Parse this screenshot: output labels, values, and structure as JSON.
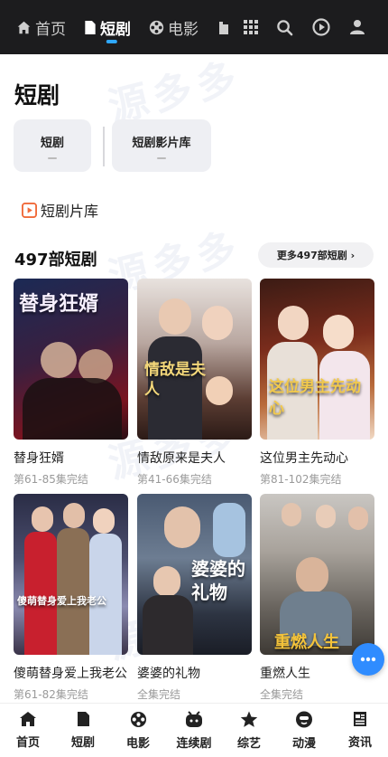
{
  "topnav": {
    "items": [
      {
        "label": "首页",
        "icon": "home-icon"
      },
      {
        "label": "短剧",
        "icon": "document-icon",
        "active": true
      },
      {
        "label": "电影",
        "icon": "film-reel-icon"
      }
    ],
    "right_icons": [
      "tv-icon",
      "grid-icon",
      "search-icon",
      "play-circle-icon",
      "user-icon"
    ],
    "accent": "#2fa8ff",
    "background": "#1c1c1e"
  },
  "watermark": "源多多",
  "page_title": "短剧",
  "categories": [
    {
      "label": "短剧"
    },
    {
      "label": "短剧影片库"
    }
  ],
  "library_label": "短剧片库",
  "section": {
    "title": "497部短剧",
    "more_label": "更多497部短剧 ›"
  },
  "cards": [
    {
      "title": "替身狂婿",
      "sub": "第61-85集完结",
      "poster_text": "替身狂婿"
    },
    {
      "title": "情敌原来是夫人",
      "sub": "第41-66集完结",
      "poster_text": "情敌是夫人"
    },
    {
      "title": "这位男主先动心",
      "sub": "第81-102集完结",
      "poster_text": "这位男主先动心"
    },
    {
      "title": "傻萌替身爱上我老公",
      "sub": "第61-82集完结",
      "poster_text": "傻萌替身爱上我老公"
    },
    {
      "title": "婆婆的礼物",
      "sub": "全集完结",
      "poster_text": "婆婆的礼物"
    },
    {
      "title": "重燃人生",
      "sub": "全集完结",
      "poster_text": "重燃人生"
    }
  ],
  "fab_icon": "more-dots-icon",
  "bottomnav": [
    {
      "label": "首页",
      "icon": "home-icon"
    },
    {
      "label": "短剧",
      "icon": "document-icon"
    },
    {
      "label": "电影",
      "icon": "film-reel-icon"
    },
    {
      "label": "连续剧",
      "icon": "tv-icon"
    },
    {
      "label": "综艺",
      "icon": "star-icon"
    },
    {
      "label": "动漫",
      "icon": "cartoon-face-icon"
    },
    {
      "label": "资讯",
      "icon": "news-icon"
    }
  ]
}
